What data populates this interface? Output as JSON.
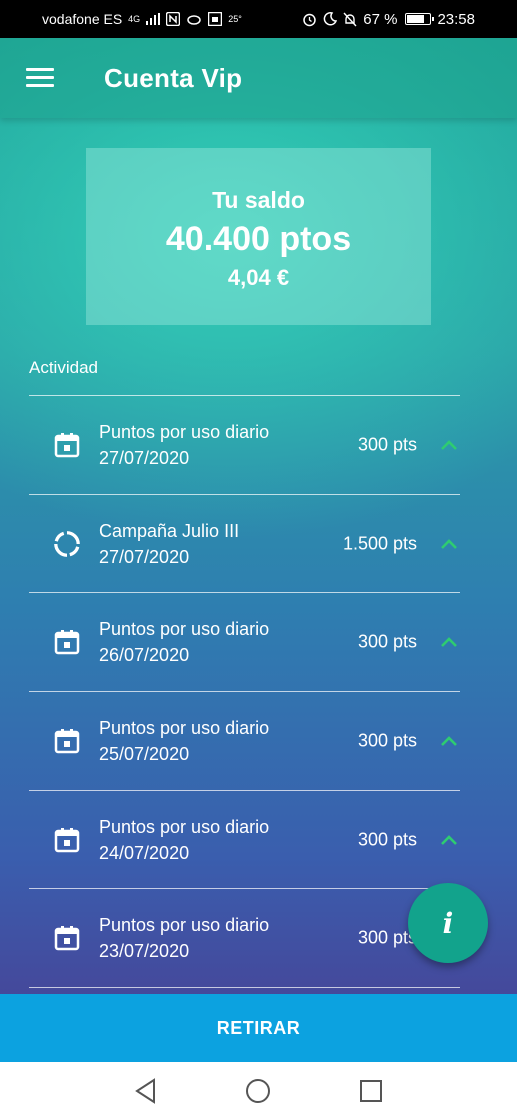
{
  "status_bar": {
    "carrier": "vodafone ES",
    "network": "4G",
    "temperature": "25°",
    "battery": "67 %",
    "time": "23:58"
  },
  "app_bar": {
    "title": "Cuenta Vip"
  },
  "balance": {
    "label": "Tu saldo",
    "points": "40.400 ptos",
    "euros": "4,04 €"
  },
  "activity": {
    "title": "Actividad",
    "items": [
      {
        "icon": "calendar-icon",
        "title": "Puntos por uso diario",
        "date": "27/07/2020",
        "points": "300 pts"
      },
      {
        "icon": "campaign-ring-icon",
        "title": "Campaña Julio III",
        "date": "27/07/2020",
        "points": "1.500 pts"
      },
      {
        "icon": "calendar-icon",
        "title": "Puntos por uso diario",
        "date": "26/07/2020",
        "points": "300 pts"
      },
      {
        "icon": "calendar-icon",
        "title": "Puntos por uso diario",
        "date": "25/07/2020",
        "points": "300 pts"
      },
      {
        "icon": "calendar-icon",
        "title": "Puntos por uso diario",
        "date": "24/07/2020",
        "points": "300 pts"
      },
      {
        "icon": "calendar-icon",
        "title": "Puntos por uso diario",
        "date": "23/07/2020",
        "points": "300 pts"
      }
    ]
  },
  "fab": {
    "label": "i"
  },
  "withdraw_button": {
    "label": "RETIRAR"
  },
  "colors": {
    "accent_green": "#2ecc71",
    "fab": "#12a38c",
    "button": "#0ca2e0"
  }
}
